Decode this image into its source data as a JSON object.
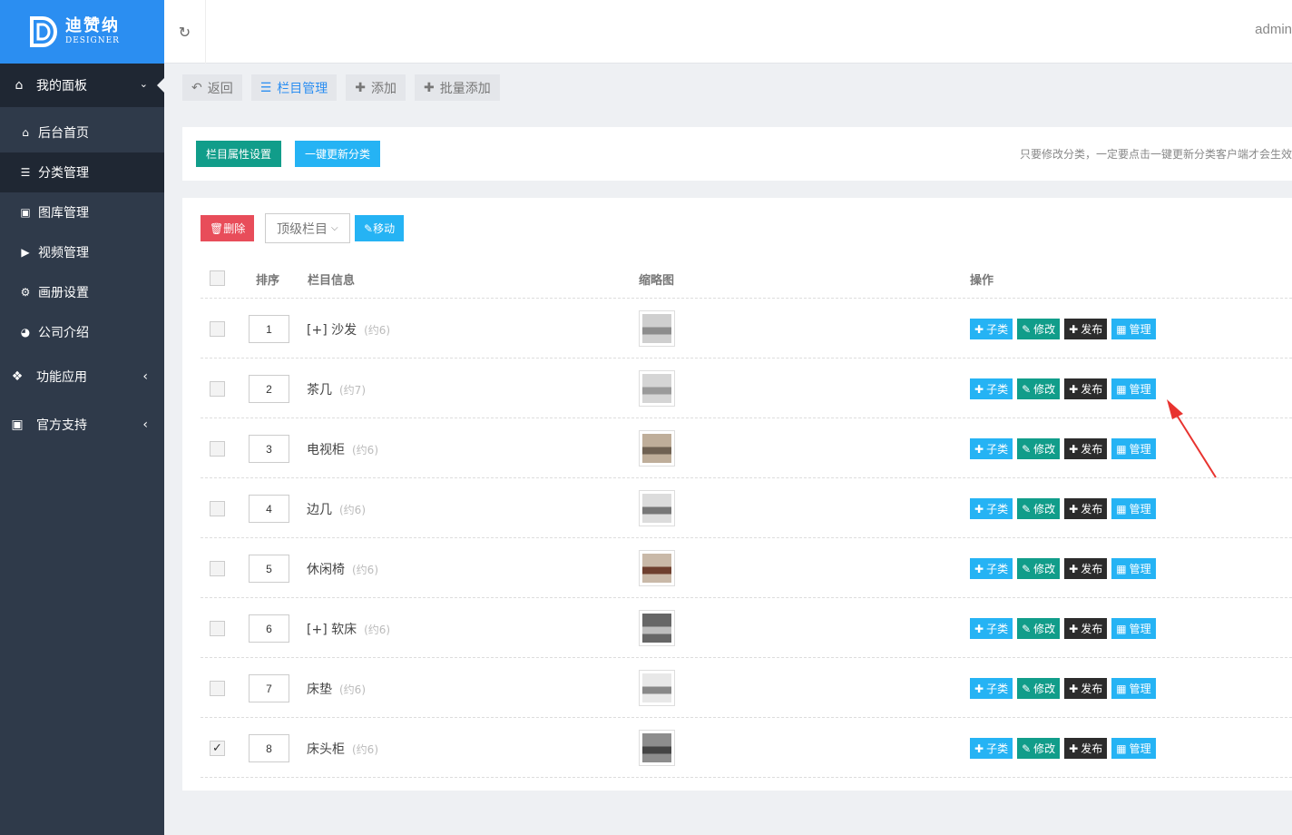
{
  "brand": {
    "name": "迪赞纳",
    "sub": "DESIGNER",
    "logo_icon": "d-logo-icon"
  },
  "header": {
    "user": "admin",
    "refresh_icon": "refresh-icon"
  },
  "sidebar": {
    "top": {
      "label": "我的面板",
      "icon": "home-icon"
    },
    "items": [
      {
        "label": "后台首页",
        "icon": "home-icon"
      },
      {
        "label": "分类管理",
        "icon": "list-icon",
        "active": true
      },
      {
        "label": "图库管理",
        "icon": "image-icon"
      },
      {
        "label": "视频管理",
        "icon": "video-icon"
      },
      {
        "label": "画册设置",
        "icon": "gear-icon"
      },
      {
        "label": "公司介绍",
        "icon": "compass-icon"
      }
    ],
    "groups": [
      {
        "label": "功能应用",
        "icon": "puzzle-icon"
      },
      {
        "label": "官方支持",
        "icon": "support-icon"
      }
    ]
  },
  "toolbar": {
    "back": "返回",
    "column_manage": "栏目管理",
    "add": "添加",
    "batch_add": "批量添加"
  },
  "panel": {
    "attr_settings": "栏目属性设置",
    "update_all": "一键更新分类",
    "tip": "只要修改分类，一定要点击一键更新分类客户端才会生效"
  },
  "list": {
    "delete": "删除",
    "select_value": "顶级栏目",
    "move": "移动",
    "headers": {
      "order": "排序",
      "info": "栏目信息",
      "thumb": "缩略图",
      "ops": "操作"
    },
    "op_labels": {
      "sub": "子类",
      "edit": "修改",
      "publish": "发布",
      "manage": "管理"
    },
    "rows": [
      {
        "order": "1",
        "name": "[+] 沙发",
        "count": "(约6)",
        "checked": false
      },
      {
        "order": "2",
        "name": "茶几",
        "count": "(约7)",
        "checked": false
      },
      {
        "order": "3",
        "name": "电视柜",
        "count": "(约6)",
        "checked": false
      },
      {
        "order": "4",
        "name": "边几",
        "count": "(约6)",
        "checked": false
      },
      {
        "order": "5",
        "name": "休闲椅",
        "count": "(约6)",
        "checked": false
      },
      {
        "order": "6",
        "name": "[+] 软床",
        "count": "(约6)",
        "checked": false
      },
      {
        "order": "7",
        "name": "床垫",
        "count": "(约6)",
        "checked": false
      },
      {
        "order": "8",
        "name": "床头柜",
        "count": "(约6)",
        "checked": true
      }
    ]
  },
  "colors": {
    "brand_blue": "#2b8ef1",
    "sidebar": "#2f3a4a",
    "teal": "#119d8a",
    "cyan": "#25b3f4",
    "red": "#e84d5a",
    "annotation_arrow": "#e8332f"
  }
}
